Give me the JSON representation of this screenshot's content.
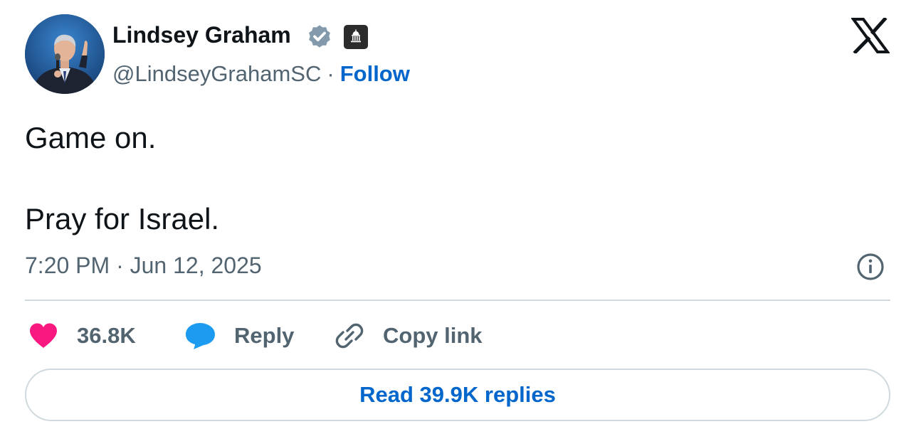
{
  "author": {
    "display_name": "Lindsey Graham",
    "handle": "@LindseyGrahamSC",
    "separator": "·",
    "follow_label": "Follow",
    "verified_icon": "verified-badge-icon",
    "affiliation_icon": "government-building-icon"
  },
  "tweet": {
    "lines": [
      "Game on.",
      "Pray for Israel."
    ],
    "timestamp": "7:20 PM · Jun 12, 2025"
  },
  "actions": {
    "like_count": "36.8K",
    "reply_label": "Reply",
    "copy_link_label": "Copy link"
  },
  "read_replies_label": "Read 39.9K replies",
  "colors": {
    "like_pink": "#f91880",
    "reply_blue": "#1d9bf0",
    "link_blue": "#0066cc",
    "muted_gray": "#536471",
    "text_dark": "#0f1419",
    "border_gray": "#cfd9de"
  }
}
